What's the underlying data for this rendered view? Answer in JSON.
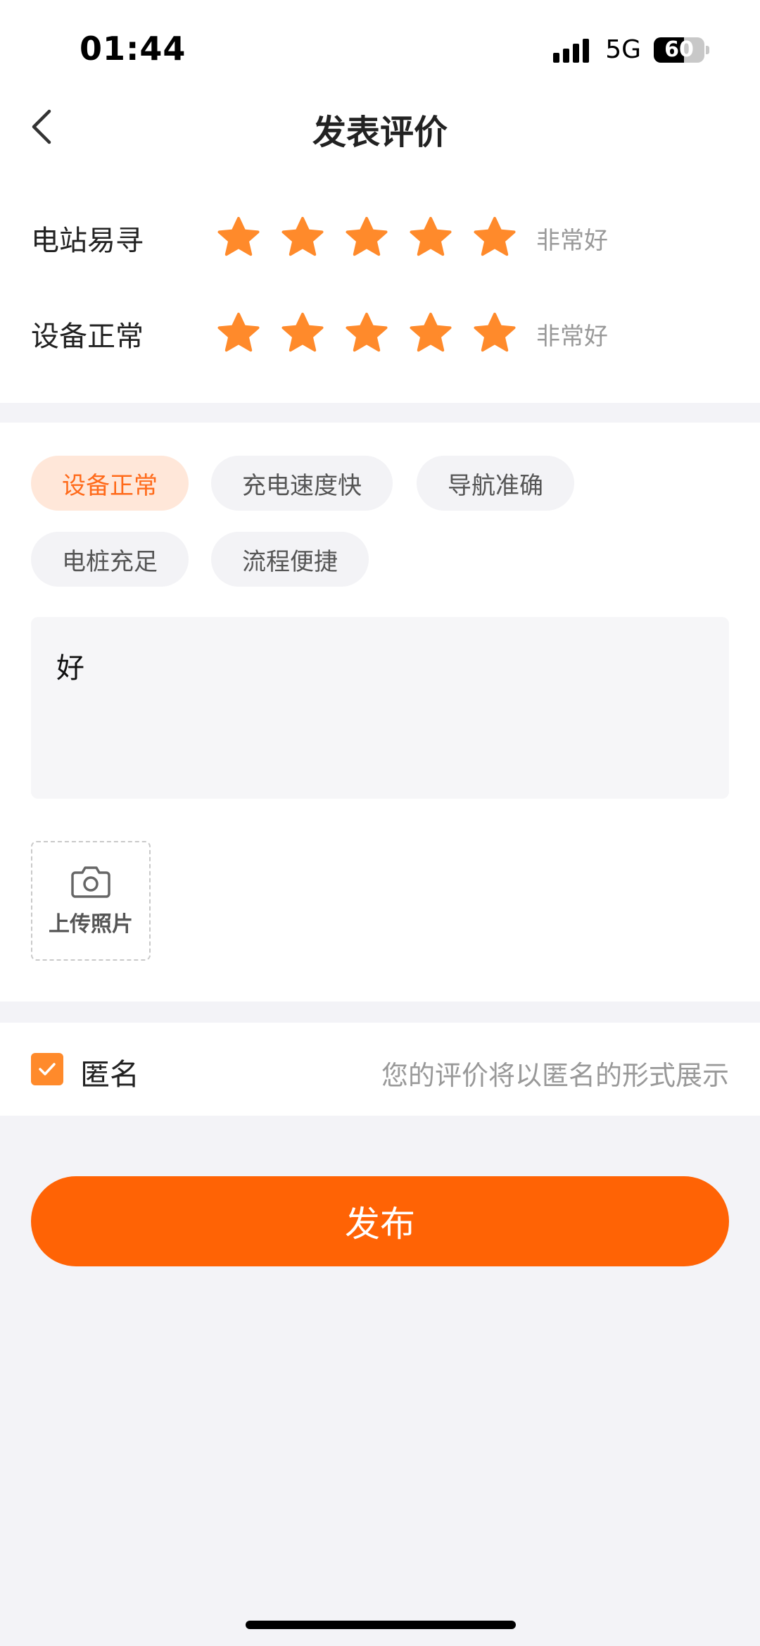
{
  "status_bar": {
    "time": "01:44",
    "network": "5G",
    "battery": "60",
    "battery_level_percent": 60
  },
  "nav": {
    "title": "发表评价",
    "back_icon": "chevron-left-icon"
  },
  "ratings": [
    {
      "label": "电站易寻",
      "stars_filled": 5,
      "stars_total": 5,
      "text": "非常好"
    },
    {
      "label": "设备正常",
      "stars_filled": 5,
      "stars_total": 5,
      "text": "非常好"
    }
  ],
  "tags": [
    {
      "label": "设备正常",
      "selected": true
    },
    {
      "label": "充电速度快",
      "selected": false
    },
    {
      "label": "导航准确",
      "selected": false
    },
    {
      "label": "电桩充足",
      "selected": false
    },
    {
      "label": "流程便捷",
      "selected": false
    }
  ],
  "comment": {
    "value": "好"
  },
  "upload": {
    "label": "上传照片",
    "icon": "camera-icon"
  },
  "anonymous": {
    "checked": true,
    "label": "匿名",
    "hint": "您的评价将以匿名的形式展示"
  },
  "publish": {
    "label": "发布"
  },
  "colors": {
    "accent": "#ff6305",
    "star": "#ff8a2b",
    "tag_active_bg": "#ffe7d9",
    "tag_active_text": "#ff6a1a"
  }
}
